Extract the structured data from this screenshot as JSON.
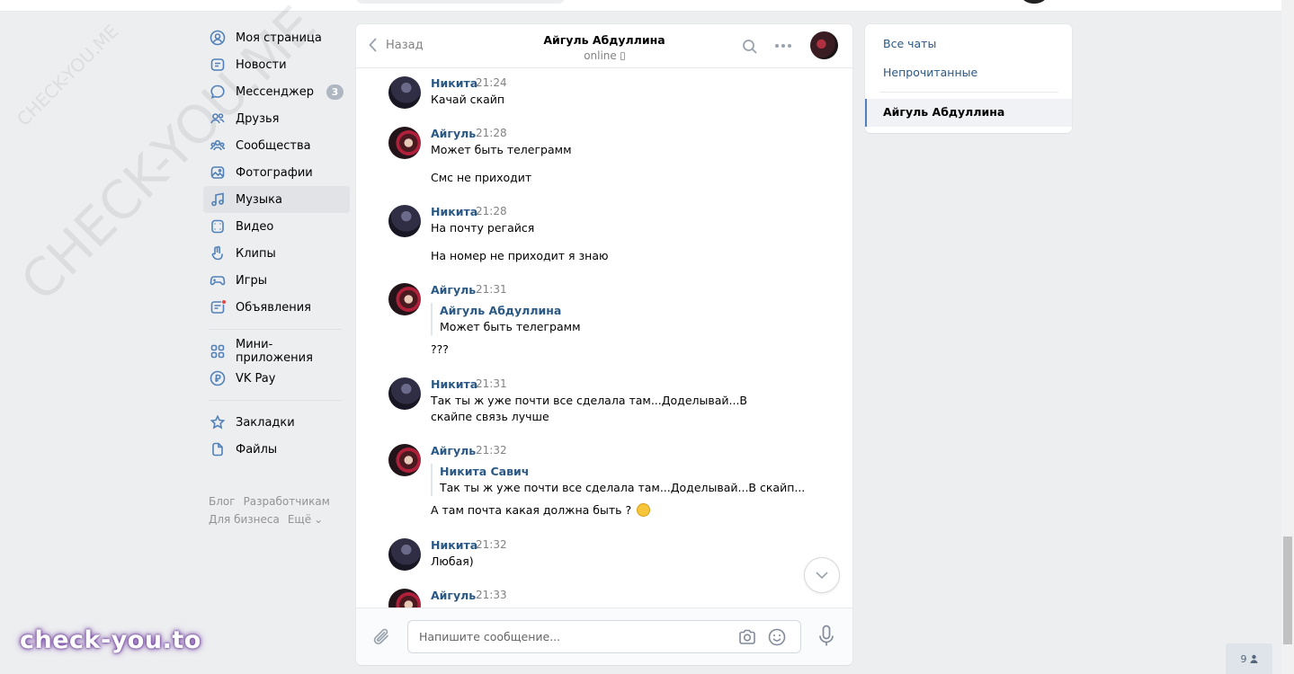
{
  "watermark": {
    "text_big": "CHECK-YOU.ME",
    "text_small": "CHECK-YOU.ME",
    "logo": "check-you.to"
  },
  "nav": {
    "items": [
      {
        "label": "Моя страница",
        "icon": "user-circle-icon"
      },
      {
        "label": "Новости",
        "icon": "news-icon"
      },
      {
        "label": "Мессенджер",
        "icon": "chat-bubble-icon",
        "badge": "3"
      },
      {
        "label": "Друзья",
        "icon": "friends-icon"
      },
      {
        "label": "Сообщества",
        "icon": "communities-icon"
      },
      {
        "label": "Фотографии",
        "icon": "photo-icon"
      },
      {
        "label": "Музыка",
        "icon": "music-icon"
      },
      {
        "label": "Видео",
        "icon": "video-icon"
      },
      {
        "label": "Клипы",
        "icon": "clips-icon"
      },
      {
        "label": "Игры",
        "icon": "gamepad-icon"
      },
      {
        "label": "Объявления",
        "icon": "ads-icon"
      },
      {
        "label": "Мини-приложения",
        "icon": "apps-icon"
      },
      {
        "label": "VK Pay",
        "icon": "vkpay-icon"
      },
      {
        "label": "Закладки",
        "icon": "star-icon"
      },
      {
        "label": "Файлы",
        "icon": "file-icon"
      }
    ],
    "footer": {
      "blog": "Блог",
      "dev": "Разработчикам",
      "business": "Для бизнеса",
      "more": "Ещё"
    }
  },
  "chat": {
    "back_label": "Назад",
    "title": "Айгуль Абдуллина",
    "status": "online",
    "messages": [
      {
        "author": "Никита",
        "time": "21:24",
        "lines": [
          "Качай скайп"
        ]
      },
      {
        "author": "Айгуль",
        "time": "21:28",
        "lines": [
          "Может быть телеграмм",
          "Смс не приходит"
        ]
      },
      {
        "author": "Никита",
        "time": "21:28",
        "lines": [
          "На почту регайся",
          "На номер не приходит я знаю"
        ]
      },
      {
        "author": "Айгуль",
        "time": "21:31",
        "reply_name": "Айгуль Абдуллина",
        "reply_text": "Может быть телеграмм",
        "lines": [
          "???"
        ]
      },
      {
        "author": "Никита",
        "time": "21:31",
        "lines": [
          "Так ты ж уже почти все сделала там...Доделывай...В скайпе связь лучше"
        ]
      },
      {
        "author": "Айгуль",
        "time": "21:32",
        "reply_name": "Никита Савич",
        "reply_text": "Так ты ж уже почти все сделала там...Доделывай...В скайп...",
        "lines": [
          "А там почта какая должна быть ?"
        ]
      },
      {
        "author": "Никита",
        "time": "21:32",
        "lines": [
          "Любая)"
        ]
      },
      {
        "author": "Айгуль",
        "time": "21:33",
        "lines": []
      }
    ],
    "composer_placeholder": "Напишите сообщение..."
  },
  "right_panel": {
    "all_chats": "Все чаты",
    "unread": "Непрочитанные",
    "active_chat": "Айгуль Абдуллина"
  },
  "online_widget": {
    "count": "9"
  },
  "colors": {
    "accent": "#5181b8",
    "link": "#2a5885",
    "bg": "#edeef0"
  }
}
